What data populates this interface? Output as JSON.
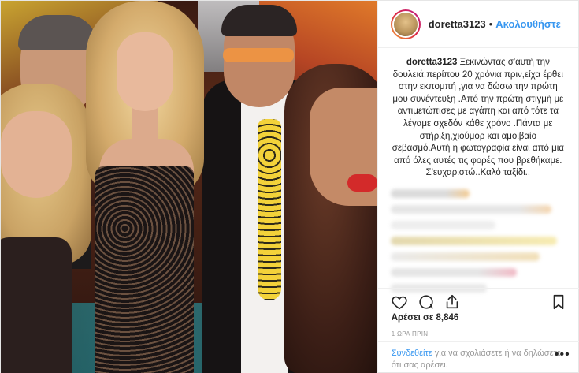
{
  "header": {
    "username": "doretta3123",
    "separator": "•",
    "follow_label": "Ακολουθήστε"
  },
  "caption": {
    "username": "doretta3123",
    "text": "Ξεκινώντας σ'αυτή την δουλειά,περίπου 20 χρόνια πριν,είχα έρθει στην εκπομπή ,για να δώσω την πρώτη μου συνέντευξη .Από την πρώτη στιγμή με αντιμετώπισες με αγάπη και από τότε τα λέγαμε σχεδόν κάθε χρόνο .Πάντα με στήριξη,χιούμορ και αμοιβαίο σεβασμό.Αυτή η φωτογραφία είναι από μια από όλες αυτές τις φορές που βρεθήκαμε. Σ'ευχαριστώ..Καλό ταξίδι.."
  },
  "blurred_comments": [
    {
      "color": "#d7d7d7",
      "accent": "#f2c78a"
    },
    {
      "color": "#e3e3e3",
      "accent": "#f4d2a8"
    },
    {
      "color": "#ececec",
      "accent": "#f5e4b0"
    },
    {
      "color": "#e0d4a6",
      "accent": "#f6e9a8"
    },
    {
      "color": "#e2e2e2",
      "accent": "#f0b3c0"
    },
    {
      "color": "#dedede",
      "accent": "#ffffff"
    },
    {
      "color": "#e6e6e6",
      "accent": "#ffffff"
    }
  ],
  "actions": {
    "like_icon": "heart-icon",
    "comment_icon": "comment-icon",
    "share_icon": "share-icon",
    "save_icon": "bookmark-icon"
  },
  "likes": "Αρέσει σε 8,846",
  "timestamp": "1 ΩΡΑ ΠΡΙΝ",
  "login_prompt": {
    "link": "Συνδεθείτε",
    "text": " για να σχολιάσετε ή να δηλώσετε ότι σας αρέσει."
  },
  "more_label": "•••",
  "colors": {
    "link_blue": "#3897f0",
    "text_dark": "#262626",
    "text_muted": "#999999",
    "border": "#efefef"
  }
}
